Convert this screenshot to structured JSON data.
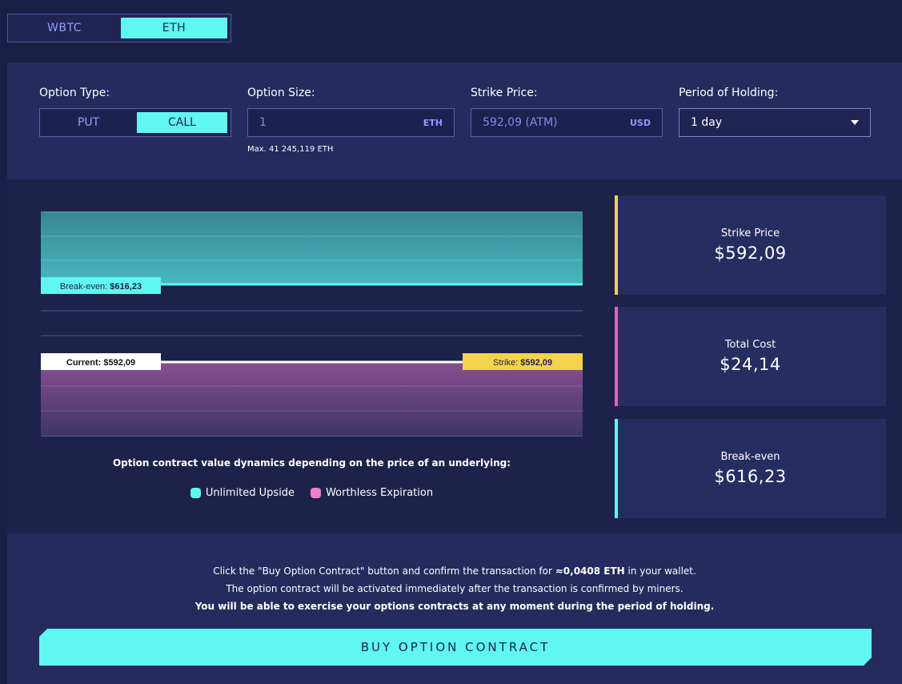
{
  "asset_toggle": {
    "options": [
      "WBTC",
      "ETH"
    ],
    "selected": "ETH"
  },
  "form": {
    "option_type": {
      "label": "Option Type:",
      "options": [
        "PUT",
        "CALL"
      ],
      "selected": "CALL"
    },
    "option_size": {
      "label": "Option Size:",
      "value": "1",
      "unit": "ETH",
      "hint": "Max. 41 245,119 ETH"
    },
    "strike_price": {
      "label": "Strike Price:",
      "value": "592,09 (ATM)",
      "unit": "USD"
    },
    "period": {
      "label": "Period of Holding:",
      "value": "1 day"
    }
  },
  "chart": {
    "tags": {
      "break_even_prefix": "Break-even: ",
      "break_even_value": "$616,23",
      "current_prefix": "Current: ",
      "current_value": "$592,09",
      "strike_prefix": "Strike: ",
      "strike_value": "$592,09"
    },
    "caption": "Option contract value dynamics depending on the price of an underlying:",
    "legend": [
      {
        "label": "Unlimited Upside",
        "color": "#5ff7ef"
      },
      {
        "label": "Worthless Expiration",
        "color": "#ef7fc8"
      }
    ]
  },
  "stats": [
    {
      "label": "Strike Price",
      "value": "$592,09",
      "accent": "#f5d34a"
    },
    {
      "label": "Total Cost",
      "value": "$24,14",
      "accent": "#e065b4"
    },
    {
      "label": "Break-even",
      "value": "$616,23",
      "accent": "#5ff7ef"
    }
  ],
  "info": {
    "line1_pre": "Click the \"Buy Option Contract\" button and confirm the transaction for ",
    "line1_bold": "≈0,0408 ETH",
    "line1_post": " in your wallet.",
    "line2": "The option contract will be activated immediately after the transaction is confirmed by miners.",
    "line3": "You will be able to exercise your options contracts at any moment during the period of holding."
  },
  "buy_button": "BUY OPTION CONTRACT",
  "colors": {
    "accent_cyan": "#5ff7ef",
    "accent_yellow": "#f5d34a",
    "accent_pink": "#e065b4",
    "panel": "#252b5e"
  }
}
